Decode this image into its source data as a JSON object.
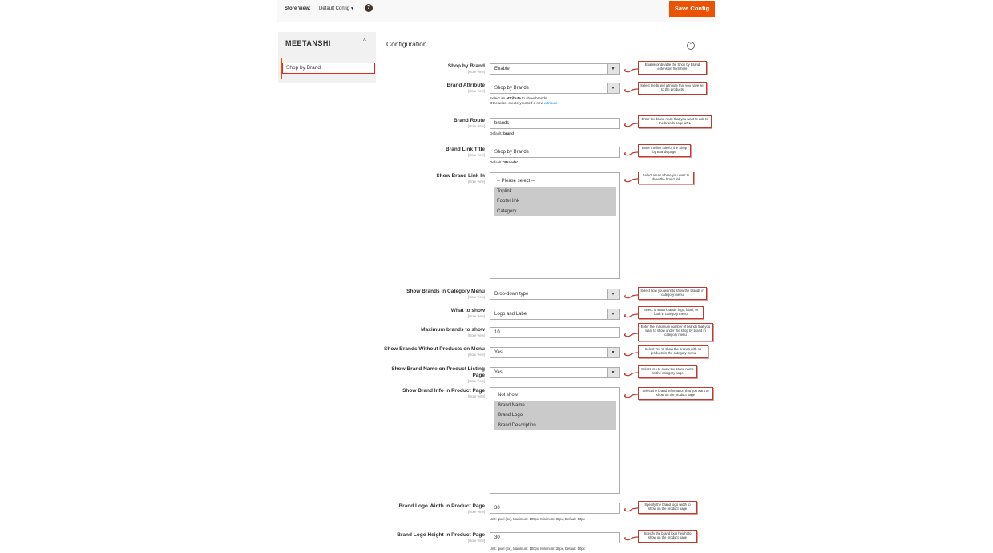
{
  "header": {
    "store_view_label": "Store View:",
    "store_view_value": "Default Config",
    "save_label": "Save Config"
  },
  "sidebar": {
    "brand": "MEETANSHI",
    "items": [
      {
        "label": "Shop by Brand"
      }
    ]
  },
  "section": {
    "title": "Configuration"
  },
  "scope_text": "[store view]",
  "fields": [
    {
      "label": "Shop by Brand",
      "value": "Enable",
      "callout": "Enable or disable the Shop by Brand extension from here"
    },
    {
      "label": "Brand Attribute",
      "value": "Shop by Brands",
      "note1_pre": "Select an ",
      "note1_bold": "attribute",
      "note1_post": " to show brands.",
      "note2_pre": "Otherwise, create yourself a new ",
      "note2_link": "attribute",
      "note2_post": " .",
      "callout": "Select the brand attribute that you have set to the products"
    },
    {
      "label": "Brand Route",
      "value": "brands",
      "note_pre": "Default: ",
      "note_bold": "brand",
      "callout": "Enter the brand route that you want to add to the brands page URL"
    },
    {
      "label": "Brand Link Title",
      "value": "Shop by Brands",
      "note_pre": "Default: ",
      "note_bold": "'Brands'",
      "callout": "Enter the link title for the Shop by Brands page"
    },
    {
      "label": "Show Brand Link In",
      "options": [
        "-- Please select --",
        "Toplink",
        "Footer link",
        "Category"
      ],
      "callout": "Select areas where you want to show the brand link"
    },
    {
      "label": "Show Brands in Category Menu",
      "value": "Drop-down type",
      "callout": "Select how you want to show the brands in category menu"
    },
    {
      "label": "What to show",
      "value": "Logo and Label",
      "callout": "Select to show brands' logo, label, or both in category menu"
    },
    {
      "label": "Maximum brands to show",
      "value": "10",
      "callout": "Enter the maximum number of brands that you want to show under the shop by brand in category menu"
    },
    {
      "label": "Show Brands Without Products on Menu",
      "value": "Yes",
      "callout": "Select Yes to show the brands with no products in the category menu"
    },
    {
      "label": "Show Brand Name on Product Listing Page",
      "value": "Yes",
      "callout": "Select Yes to show the brand name on the category page"
    },
    {
      "label": "Show Brand Info in Product Page",
      "options": [
        "Not show",
        "Brand Name",
        "Brand Logo",
        "Brand Description"
      ],
      "callout": "Select the brand information that you want to show on the product page"
    },
    {
      "label": "Brand Logo Width in Product Page",
      "value": "30",
      "note": "Unit: pixel (px), Maximum: 100px, Minimum: 30px, Default: 50px",
      "callout": "Specify the brand logo width to show on the product page"
    },
    {
      "label": "Brand Logo Height in Product Page",
      "value": "30",
      "note": "Unit: pixel (px), Maximum: 100px, Minimum: 30px, Default: 50px",
      "callout": "Specify the brand logo height to show on the product page"
    }
  ],
  "colors": {
    "accent": "#eb5202",
    "callout_border": "#c0392b"
  }
}
